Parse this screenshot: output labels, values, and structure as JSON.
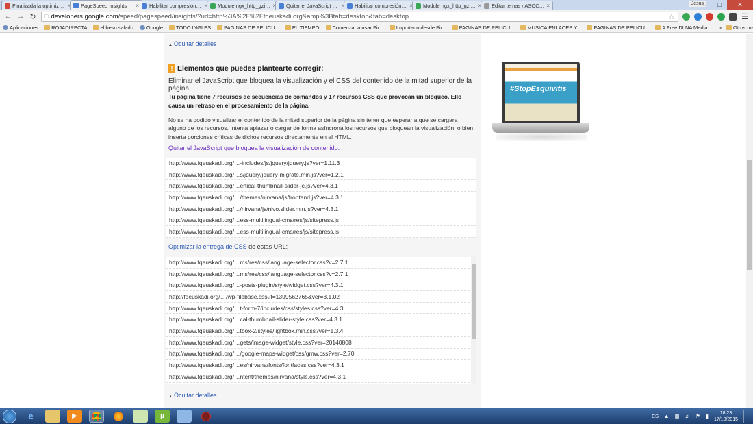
{
  "browser": {
    "tabs": [
      {
        "title": "Finalizada la optimización",
        "color": "#d44638",
        "active": false
      },
      {
        "title": "PageSpeed Insights",
        "color": "#4a7fd6",
        "active": true
      },
      {
        "title": "Habilitar compresión | Pa",
        "color": "#4a7fd6",
        "active": false
      },
      {
        "title": "Module ngx_http_gzip_mo",
        "color": "#3aa757",
        "active": false
      },
      {
        "title": "Quitar el JavaScript que b",
        "color": "#4a7fd6",
        "active": false
      },
      {
        "title": "Habilitar compresión | Pa",
        "color": "#4a7fd6",
        "active": false
      },
      {
        "title": "Module ngx_http_gzip_mo",
        "color": "#3aa757",
        "active": false
      },
      {
        "title": "Editar temas ‹ ASOCIACI",
        "color": "#999999",
        "active": false
      }
    ],
    "profile": "Jesús",
    "url_host": "developers.google.com",
    "url_path": "/speed/pagespeed/insights/?url=http%3A%2F%2Ffqeuskadi.org&amp%3Btab=desktop&tab=desktop",
    "bookmarks": [
      "Aplicaciones",
      "ROJADIRECTA",
      "el beso salado",
      "Google",
      "TODO INGLES",
      "PAGINAS DE PELICU...",
      "EL TIEMPO",
      "Comenzar a usar Fir...",
      "Importado desde Fir...",
      "PAGINAS DE PELICU...",
      "MUSICA ENLACES Y...",
      "PAGINAS DE PELICU...",
      "A Free DLNA Media ..."
    ],
    "bookmarks_more": "»",
    "other_bookmarks": "Otros marcadores"
  },
  "content": {
    "toggle_top": "Ocultar detalles",
    "toggle_bottom": "Ocultar detalles",
    "warn_symbol": "!",
    "heading": "Elementos que puedes plantearte corregir:",
    "rule_title": "Eliminar el JavaScript que bloquea la visualización y el CSS del contenido de la mitad superior de la página",
    "summary": "Tu página tiene 7 recursos de secuencias de comandos y 17 recursos CSS que provocan un bloqueo. Ello causa un retraso en el procesamiento de la página.",
    "description": "No se ha podido visualizar el contenido de la mitad superior de la página sin tener que esperar a que se cargara alguno de los recursos. Intenta aplazar o cargar de forma asíncrona los recursos que bloquean la visualización, o bien inserta porciones críticas de dichos recursos directamente en el HTML.",
    "js_link": "Quitar el JavaScript que bloquea la visualización de contenido:",
    "css_link": "Optimizar la entrega de CSS",
    "css_suffix": " de estas URL:",
    "js_urls": [
      "http://www.fqeuskadi.org/…-includes/js/jquery/jquery.js?ver=1.11.3",
      "http://www.fqeuskadi.org/…s/jquery/jquery-migrate.min.js?ver=1.2.1",
      "http://www.fqeuskadi.org/…ertical-thumbnail-slider-jc.js?ver=4.3.1",
      "http://www.fqeuskadi.org/…/themes/nirvana/js/frontend.js?ver=4.3.1",
      "http://www.fqeuskadi.org/…/nirvana/js/nivo.slider.min.js?ver=4.3.1",
      "http://www.fqeuskadi.org/…ess-multilingual-cms/res/js/sitepress.js",
      "http://www.fqeuskadi.org/…ess-multilingual-cms/res/js/sitepress.js"
    ],
    "css_urls": [
      "http://www.fqeuskadi.org/…ms/res/css/language-selector.css?v=2.7.1",
      "http://www.fqeuskadi.org/…ms/res/css/language-selector.css?v=2.7.1",
      "http://www.fqeuskadi.org/…-posts-plugin/style/widget.css?ver=4.3.1",
      "http://fqeuskadi.org/…/wp-filebase.css?t=1399562765&ver=3.1.02",
      "http://www.fqeuskadi.org/…t-form-7/includes/css/styles.css?ver=4.3",
      "http://www.fqeuskadi.org/…cal-thumbnail-slider-style.css?ver=4.3.1",
      "http://www.fqeuskadi.org/…tbox-2/styles/lightbox.min.css?ver=1.3.4",
      "http://www.fqeuskadi.org/…gets/image-widget/style.css?ver=20140808",
      "http://www.fqeuskadi.org/…/google-maps-widget/css/gmw.css?ver=2.70",
      "http://www.fqeuskadi.org/…es/nirvana/fonts/fontfaces.css?ver=4.3.1",
      "http://www.fqeuskadi.org/…ntent/themes/nirvana/style.css?ver=4.3.1"
    ],
    "preview_tag": "#StopEsquivitis"
  },
  "taskbar": {
    "lang": "ES",
    "time": "18:23",
    "date": "17/10/2015"
  }
}
